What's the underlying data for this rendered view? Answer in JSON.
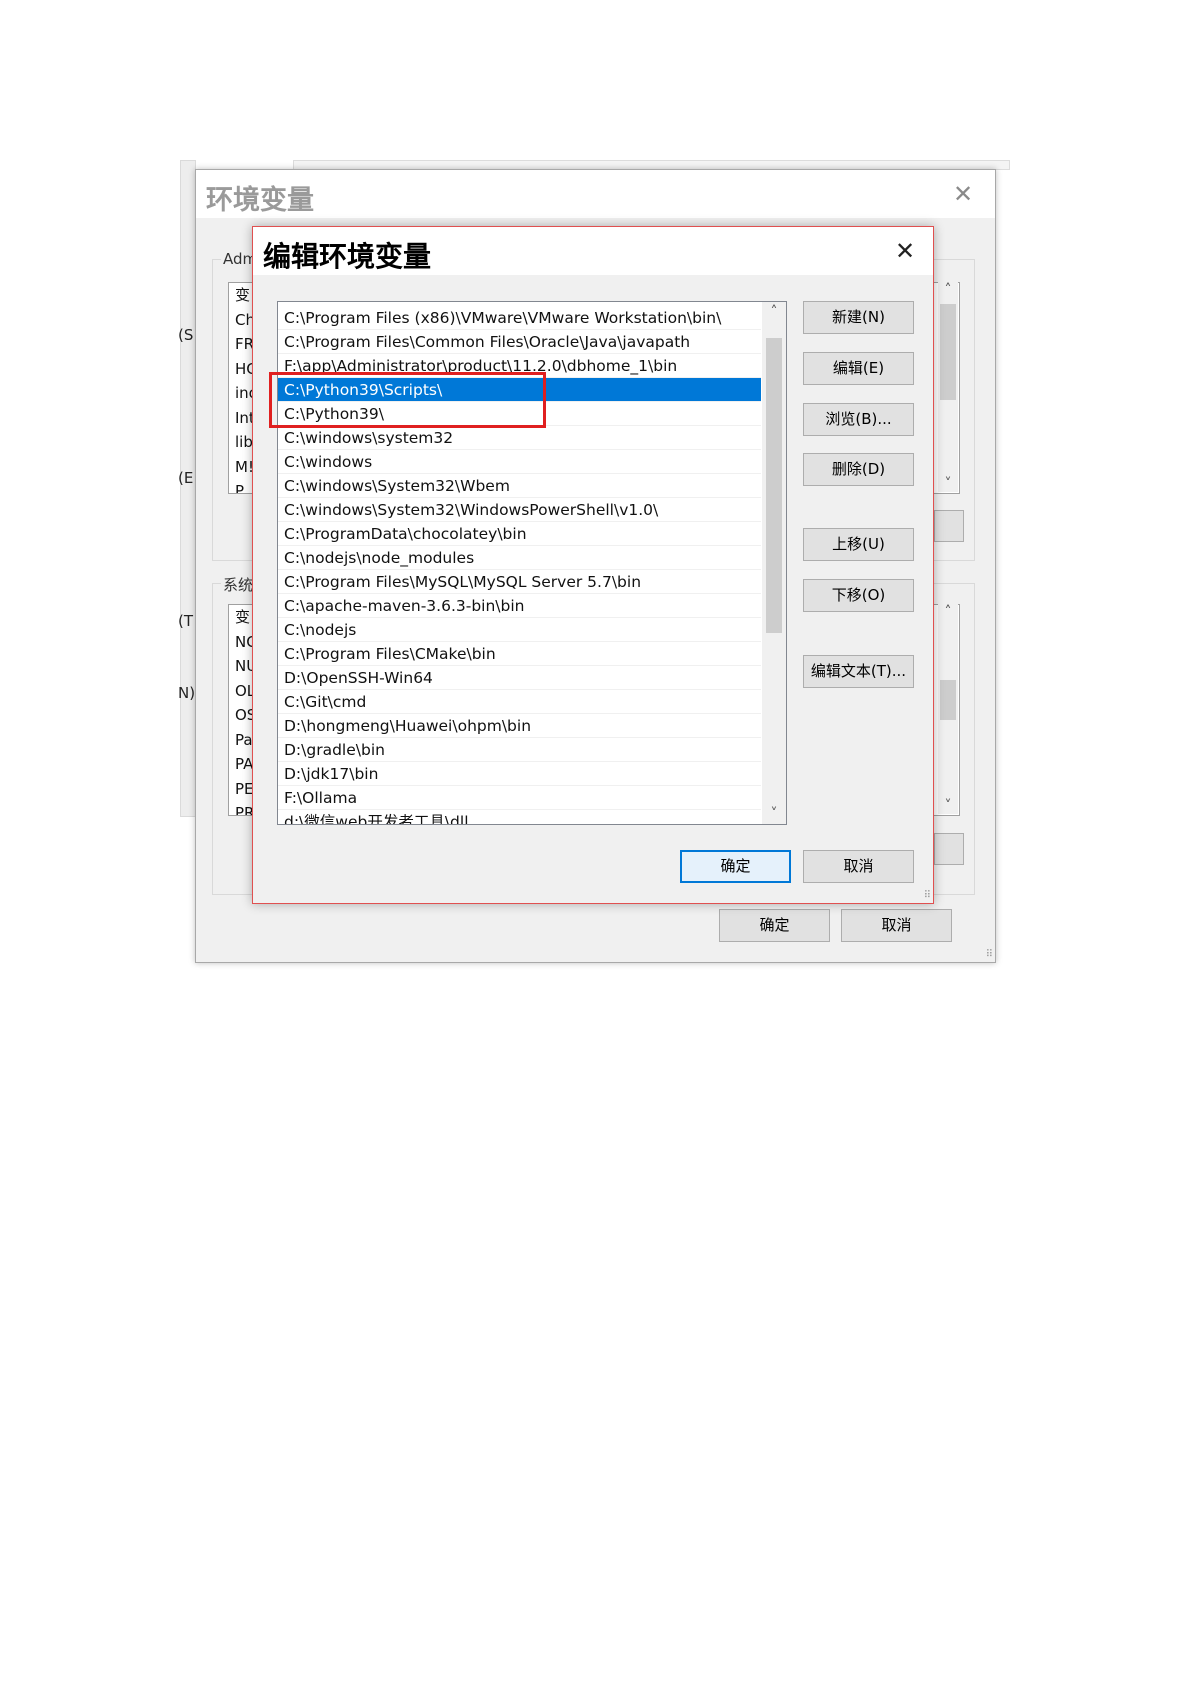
{
  "outer_dialog": {
    "title": "环境变量",
    "user_group_label": "Adm",
    "user_list_rows": [
      "变",
      "Ch",
      "FR",
      "HC",
      "ino",
      "Int",
      "lib",
      "M!",
      "P"
    ],
    "system_group_label": "系统",
    "system_list_rows": [
      "变",
      "NC",
      "NU",
      "OL",
      "OS",
      "Pa",
      "PA",
      "PE",
      "PR"
    ],
    "ok_label": "确定",
    "cancel_label": "取消"
  },
  "background_fragments": {
    "left_labels": [
      "(S",
      "(E",
      "(T",
      "N)"
    ]
  },
  "edit_dialog": {
    "title": "编辑环境变量",
    "close_glyph": "✕",
    "paths": [
      "C:\\Program Files (x86)\\VMware\\VMware Workstation\\bin\\",
      "C:\\Program Files\\Common Files\\Oracle\\Java\\javapath",
      "F:\\app\\Administrator\\product\\11.2.0\\dbhome_1\\bin",
      "C:\\Python39\\Scripts\\",
      "C:\\Python39\\",
      "C:\\windows\\system32",
      "C:\\windows",
      "C:\\windows\\System32\\Wbem",
      "C:\\windows\\System32\\WindowsPowerShell\\v1.0\\",
      "C:\\ProgramData\\chocolatey\\bin",
      "C:\\nodejs\\node_modules",
      "C:\\Program Files\\MySQL\\MySQL Server 5.7\\bin",
      "C:\\apache-maven-3.6.3-bin\\bin",
      "C:\\nodejs",
      "C:\\Program Files\\CMake\\bin",
      "D:\\OpenSSH-Win64",
      "C:\\Git\\cmd",
      "D:\\hongmeng\\Huawei\\ohpm\\bin",
      "D:\\gradle\\bin",
      "D:\\jdk17\\bin",
      "F:\\Ollama",
      "d:\\微信web开发者工具\\dll"
    ],
    "selected_index": 3,
    "buttons": {
      "new": "新建(N)",
      "edit": "编辑(E)",
      "browse": "浏览(B)...",
      "delete": "删除(D)",
      "move_up": "上移(U)",
      "move_down": "下移(O)",
      "edit_text": "编辑文本(T)...",
      "ok": "确定",
      "cancel": "取消"
    },
    "highlight_color": "#e02020",
    "selection_color": "#0078d7"
  }
}
